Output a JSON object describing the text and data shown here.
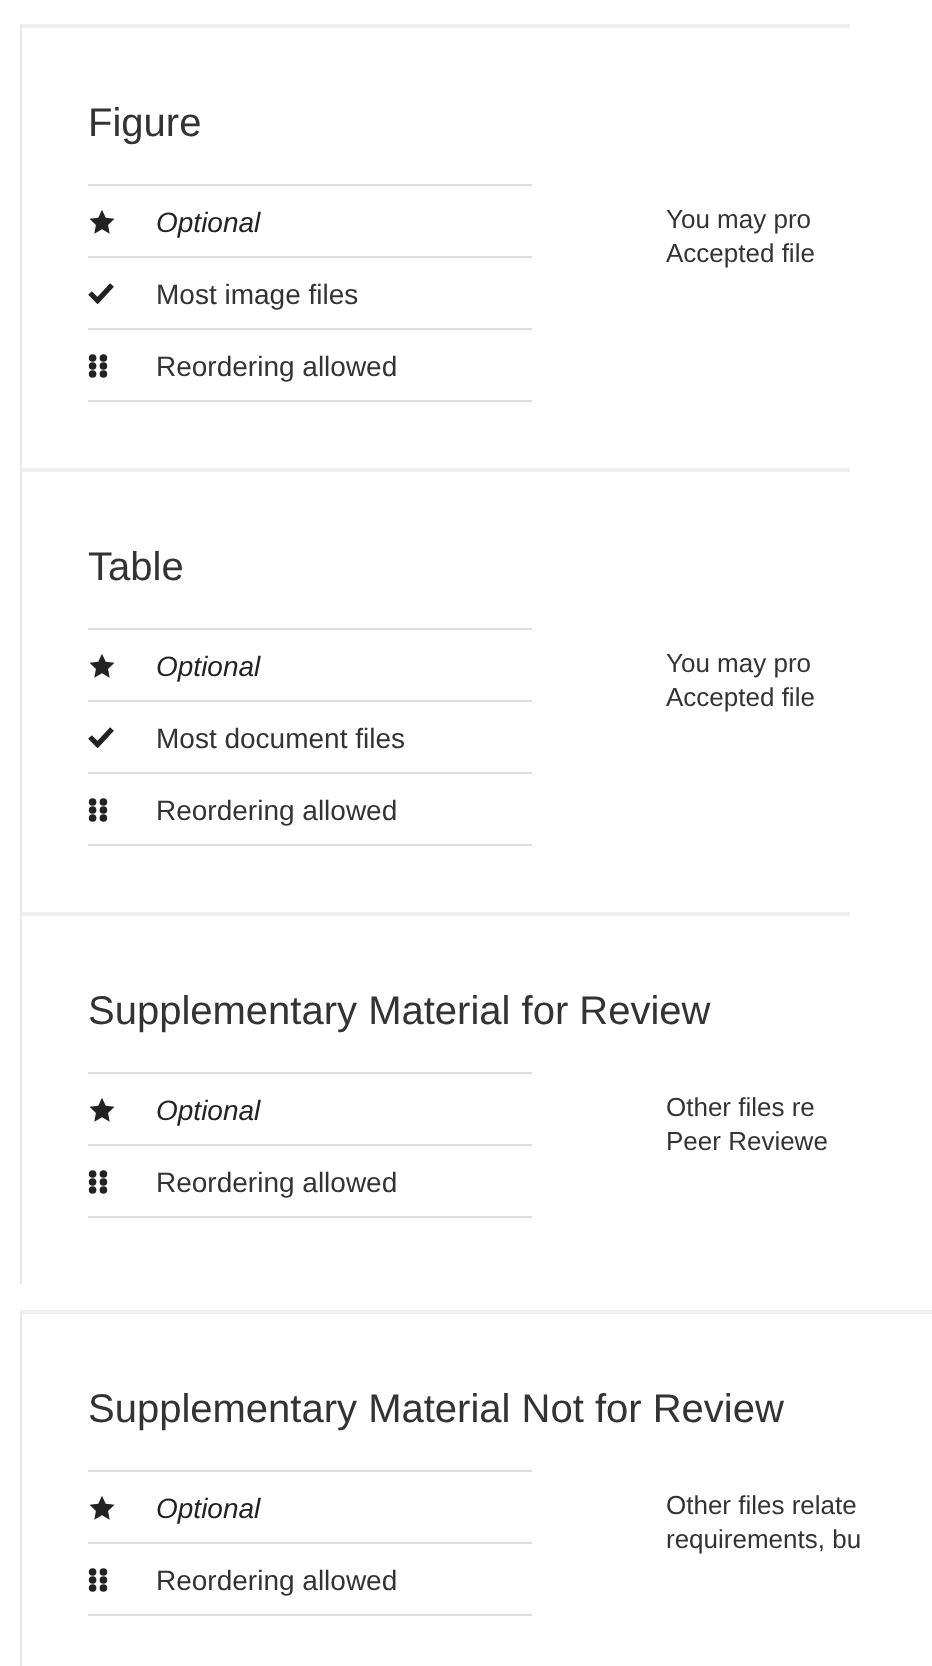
{
  "groups": [
    {
      "sections": [
        {
          "title": "Figure",
          "features": [
            {
              "kind": "requirement",
              "label": "Optional"
            },
            {
              "kind": "formats",
              "label": "Most image files"
            },
            {
              "kind": "reorder",
              "label": "Reordering allowed"
            }
          ],
          "description": [
            "You may pro",
            "Accepted file"
          ]
        },
        {
          "title": "Table",
          "features": [
            {
              "kind": "requirement",
              "label": "Optional"
            },
            {
              "kind": "formats",
              "label": "Most document files"
            },
            {
              "kind": "reorder",
              "label": "Reordering allowed"
            }
          ],
          "description": [
            "You may pro",
            "Accepted file"
          ]
        },
        {
          "title": "Supplementary Material for Review",
          "features": [
            {
              "kind": "requirement",
              "label": "Optional"
            },
            {
              "kind": "reorder",
              "label": "Reordering allowed"
            }
          ],
          "description": [
            "Other files re",
            "Peer Reviewe"
          ]
        }
      ]
    },
    {
      "sections": [
        {
          "title": "Supplementary Material Not for Review",
          "features": [
            {
              "kind": "requirement",
              "label": "Optional"
            },
            {
              "kind": "reorder",
              "label": "Reordering allowed"
            }
          ],
          "description": [
            "Other files relate",
            "requirements, bu"
          ]
        }
      ]
    }
  ]
}
